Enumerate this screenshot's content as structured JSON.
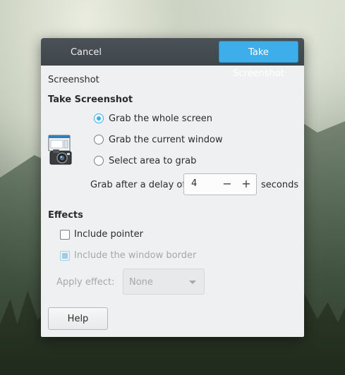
{
  "header": {
    "cancel_label": "Cancel",
    "take_label": "Take Screenshot"
  },
  "window": {
    "section_label": "Screenshot",
    "take_title": "Take Screenshot"
  },
  "grab_options": [
    {
      "label": "Grab the whole screen",
      "checked": true
    },
    {
      "label": "Grab the current window",
      "checked": false
    },
    {
      "label": "Select area to grab",
      "checked": false
    }
  ],
  "delay": {
    "prefix": "Grab after a delay of",
    "value": "4",
    "minus": "−",
    "plus": "+",
    "suffix": "seconds"
  },
  "effects": {
    "title": "Effects",
    "include_pointer": {
      "label": "Include pointer",
      "checked": false
    },
    "include_border": {
      "label": "Include the window border",
      "checked": true,
      "disabled": true
    },
    "apply_label": "Apply effect:",
    "apply_value": "None"
  },
  "footer": {
    "help_label": "Help"
  },
  "colors": {
    "accent": "#3daee9",
    "headerbar": "#444c50",
    "dialog_bg": "#eef0f1"
  },
  "icons": [
    "camera-screenshot-icon",
    "chevron-down-icon"
  ]
}
